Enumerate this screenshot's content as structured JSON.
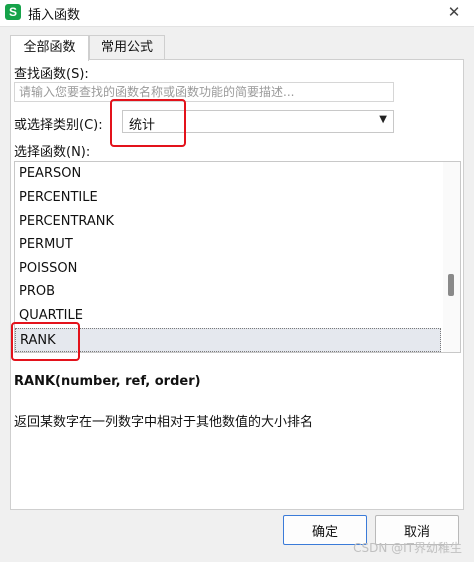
{
  "window": {
    "icon_label": "S",
    "title": "插入函数",
    "close_glyph": "✕"
  },
  "tabs": [
    {
      "label": "全部函数",
      "active": true
    },
    {
      "label": "常用公式",
      "active": false
    }
  ],
  "search": {
    "label": "查找函数(S):",
    "placeholder": "请输入您要查找的函数名称或函数功能的简要描述..."
  },
  "category": {
    "label": "或选择类别(C):",
    "selected": "统计",
    "arrow_glyph": "▼"
  },
  "function_list": {
    "label": "选择函数(N):",
    "items": [
      "PEARSON",
      "PERCENTILE",
      "PERCENTRANK",
      "PERMUT",
      "POISSON",
      "PROB",
      "QUARTILE",
      "RANK"
    ],
    "selected": "RANK"
  },
  "details": {
    "signature": "RANK(number, ref, order)",
    "description": "返回某数字在一列数字中相对于其他数值的大小排名"
  },
  "buttons": {
    "ok": "确定",
    "cancel": "取消"
  },
  "watermark": "CSDN @IT界幼稚生",
  "colors": {
    "highlight": "#e3121b",
    "app_icon": "#16a34a",
    "selection": "#e5e8ee"
  }
}
